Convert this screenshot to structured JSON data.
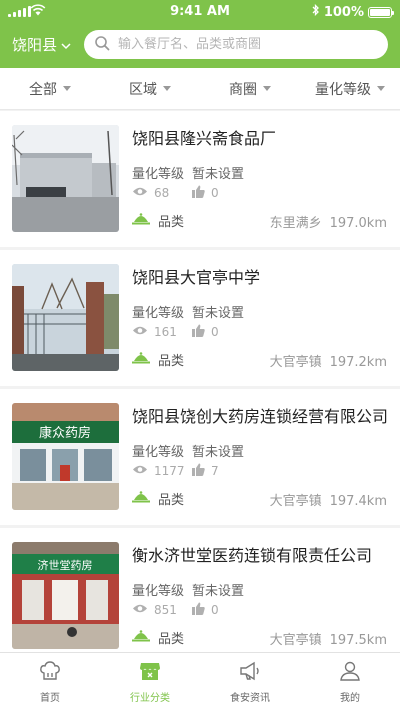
{
  "status": {
    "time": "9:41 AM",
    "battery": "100%"
  },
  "header": {
    "city": "饶阳县",
    "search_placeholder": "输入餐厅名、品类或商圈"
  },
  "filters": [
    "全部",
    "区域",
    "商圈",
    "量化等级"
  ],
  "items": [
    {
      "name": "饶阳县隆兴斋食品厂",
      "grade_label": "量化等级",
      "grade_value": "暂未设置",
      "views": "68",
      "likes": "0",
      "category": "品类",
      "town": "东里满乡",
      "distance": "197.0km",
      "thumb": "factory"
    },
    {
      "name": "饶阳县大官亭中学",
      "grade_label": "量化等级",
      "grade_value": "暂未设置",
      "views": "161",
      "likes": "0",
      "category": "品类",
      "town": "大官亭镇",
      "distance": "197.2km",
      "thumb": "school-gate"
    },
    {
      "name": "饶阳县饶创大药房连锁经营有限公司",
      "grade_label": "量化等级",
      "grade_value": "暂未设置",
      "views": "1177",
      "likes": "7",
      "category": "品类",
      "town": "大官亭镇",
      "distance": "197.4km",
      "thumb": "pharmacy-storefront",
      "sign_text": "康众药房"
    },
    {
      "name": "衡水济世堂医药连锁有限责任公司",
      "grade_label": "量化等级",
      "grade_value": "暂未设置",
      "views": "851",
      "likes": "0",
      "category": "品类",
      "town": "大官亭镇",
      "distance": "197.5km",
      "thumb": "pharmacy-storefront",
      "sign_text": "济世堂药房"
    }
  ],
  "tabs": [
    {
      "label": "首页",
      "icon": "chef-hat-icon"
    },
    {
      "label": "行业分类",
      "icon": "store-icon",
      "active": true
    },
    {
      "label": "食安资讯",
      "icon": "megaphone-icon"
    },
    {
      "label": "我的",
      "icon": "user-icon"
    }
  ],
  "colors": {
    "accent": "#7fc34a",
    "background": "#f2f2f2"
  }
}
